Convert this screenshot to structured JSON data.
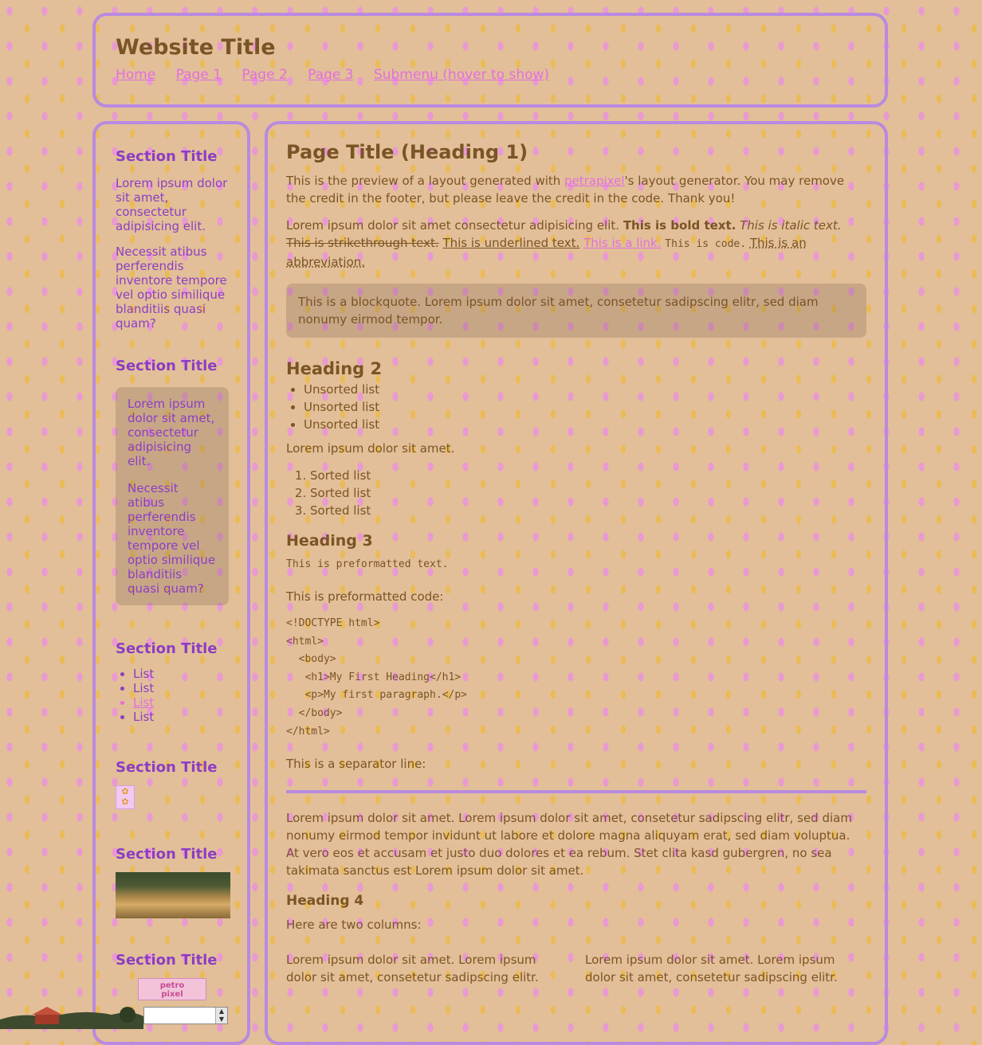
{
  "header": {
    "title": "Website Title",
    "nav": [
      "Home",
      "Page 1",
      "Page 2",
      "Page 3",
      "Submenu (hover to show)"
    ]
  },
  "sidebar": {
    "sections": [
      {
        "title": "Section Title",
        "p1": "Lorem ipsum dolor sit amet, consectetur adipisicing elit.",
        "p2": "Necessit atibus perferendis inventore tempore vel optio similique blanditiis quasi quam?"
      },
      {
        "title": "Section Title",
        "p1": "Lorem ipsum dolor sit amet, consectetur adipisicing elit.",
        "p2": "Necessit atibus perferendis inventore tempore vel optio similique blanditiis quasi quam?"
      },
      {
        "title": "Section Title",
        "items": [
          "List",
          "List",
          "List",
          "List"
        ]
      },
      {
        "title": "Section Title"
      },
      {
        "title": "Section Title"
      },
      {
        "title": "Section Title",
        "badge_line1": "petro",
        "badge_line2": "pixel"
      }
    ]
  },
  "main": {
    "h1": "Page Title (Heading 1)",
    "intro_before": "This is the preview of a layout generated with ",
    "intro_link": "petrapixel",
    "intro_after": "'s layout generator. You may remove the credit in the footer, but please leave the credit in the code. Thank you!",
    "formatting": {
      "plain": "Lorem ipsum dolor sit amet consectetur adipisicing elit. ",
      "bold": "This is bold text.",
      "italic": "This is italic text.",
      "strike": "This is strikethrough text.",
      "underline": "This is underlined text.",
      "link": "This is a link.",
      "code": "This is code.",
      "abbr": "This is an abbreviation."
    },
    "blockquote": "This is a blockquote. Lorem ipsum dolor sit amet, consetetur sadipscing elitr, sed diam nonumy eirmod tempor.",
    "h2": "Heading 2",
    "unsorted": [
      "Unsorted list",
      "Unsorted list",
      "Unsorted list"
    ],
    "after_list": "Lorem ipsum dolor sit amet.",
    "sorted": [
      "Sorted list",
      "Sorted list",
      "Sorted list"
    ],
    "h3": "Heading 3",
    "pre_text": "This is preformatted text.",
    "pre_code_label": "This is preformatted code:",
    "code_block": "<!DOCTYPE html>\n<html>\n  <body>\n   <h1>My First Heading</h1>\n   <p>My first paragraph.</p>\n  </body>\n</html>",
    "separator_label": "This is a separator line:",
    "long_paragraph": "Lorem ipsum dolor sit amet. Lorem ipsum dolor sit amet, consetetur sadipscing elitr, sed diam nonumy eirmod tempor invidunt ut labore et dolore magna aliquyam erat, sed diam voluptua. At vero eos et accusam et justo duo dolores et ea rebum. Stet clita kasd gubergren, no sea takimata sanctus est Lorem ipsum dolor sit amet.",
    "h4": "Heading 4",
    "two_cols_label": "Here are two columns:",
    "col1": "Lorem ipsum dolor sit amet. Lorem ipsum dolor sit amet, consetetur sadipscing elitr.",
    "col2": "Lorem ipsum dolor sit amet. Lorem ipsum dolor sit amet, consetetur sadipscing elitr."
  },
  "colors": {
    "background": "#e2bf98",
    "border": "#b98ae0",
    "text": "#7a5424",
    "sidebar_text": "#8c3ec4",
    "link": "#e36fe0"
  }
}
